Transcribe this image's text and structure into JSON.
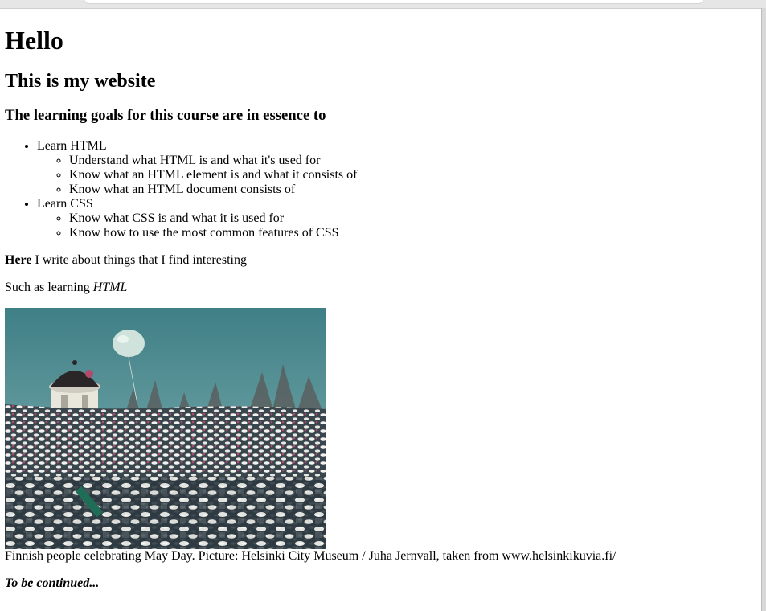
{
  "heading1": "Hello",
  "heading2": "This is my website",
  "heading3": "The learning goals for this course are in essence to",
  "goals": [
    {
      "label": "Learn HTML",
      "items": [
        "Understand what HTML is and what it's used for",
        "Know what an HTML element is and what it consists of",
        "Know what an HTML document consists of"
      ]
    },
    {
      "label": "Learn CSS",
      "items": [
        "Know what CSS is and what it is used for",
        "Know how to use the most common features of CSS"
      ]
    }
  ],
  "intro": {
    "bold": "Here",
    "rest": " I write about things that I find interesting"
  },
  "learning": {
    "text": "Such as learning ",
    "italic": "HTML"
  },
  "image": {
    "alt": "Finnish people celebrating May Day",
    "colors": {
      "sky_top": "#4b8a90",
      "sky_bottom": "#7fb1b3",
      "crowd": "#3d4a52"
    }
  },
  "caption": "Finnish people celebrating May Day. Picture: Helsinki City Museum / Juha Jernvall, taken from www.helsinkikuvia.fi/",
  "closing": "To be continued..."
}
